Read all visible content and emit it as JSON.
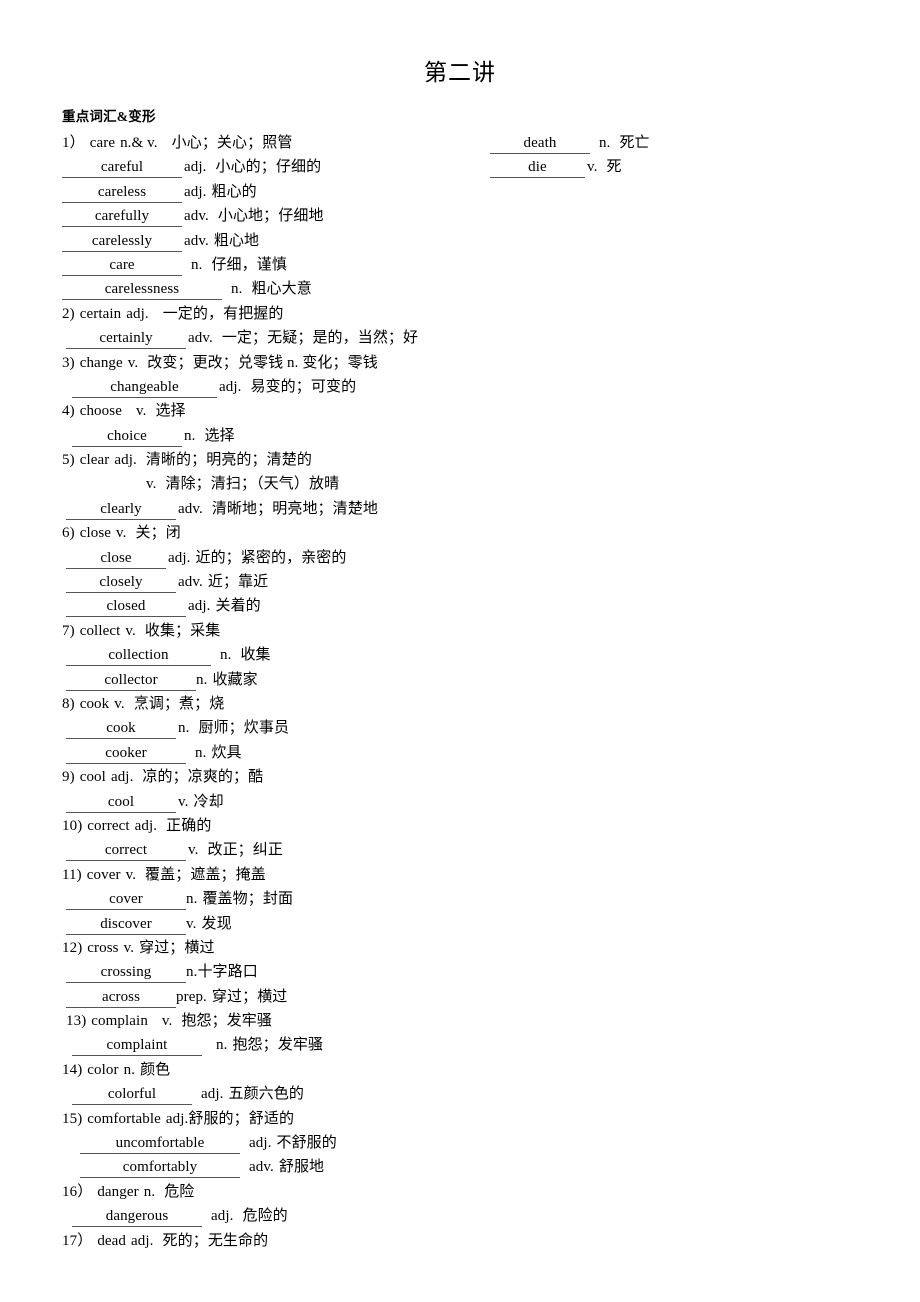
{
  "document": {
    "title": "第二讲",
    "section_heading": "重点词汇&变形"
  },
  "right_column": [
    {
      "blank": "death",
      "pos": "n.",
      "meaning": "死亡"
    },
    {
      "blank": "die",
      "pos": "v.",
      "meaning": "死"
    }
  ],
  "entries": [
    {
      "number": "1）",
      "word": "care",
      "pos": "n.& v.",
      "meaning": "小心；关心；照管",
      "forms": [
        {
          "blank": "careful",
          "pos": "adj.",
          "meaning": "小心的；仔细的"
        },
        {
          "blank": "careless",
          "pos": "adj.",
          "meaning": "粗心的"
        },
        {
          "blank": "carefully",
          "pos": "adv.",
          "meaning": "小心地；仔细地"
        },
        {
          "blank": "carelessly",
          "pos": "adv.",
          "meaning": "粗心地"
        },
        {
          "blank": "care",
          "pos": "n.",
          "meaning": "仔细，谨慎"
        },
        {
          "blank": "carelessness",
          "pos": "n.",
          "meaning": "粗心大意"
        }
      ]
    },
    {
      "number": "2)",
      "word": "certain",
      "pos": "adj.",
      "meaning": "一定的，有把握的",
      "forms": [
        {
          "blank": "certainly",
          "pos": "adv.",
          "meaning": "一定；无疑；是的，当然；好"
        }
      ]
    },
    {
      "number": "3)",
      "word": "change",
      "pos": "v.",
      "meaning": "改变；更改；兑零钱 n. 变化；零钱",
      "forms": [
        {
          "blank": "changeable",
          "pos": "adj.",
          "meaning": "易变的；可变的"
        }
      ]
    },
    {
      "number": "4)",
      "word": "choose",
      "pos": "v.",
      "meaning": "选择",
      "forms": [
        {
          "blank": "choice",
          "pos": "n.",
          "meaning": "选择"
        }
      ]
    },
    {
      "number": "5)",
      "word": "clear",
      "pos": "adj.",
      "meaning": "清晰的；明亮的；清楚的",
      "extra_sense": {
        "pos": "v.",
        "meaning": "清除；清扫；（天气）放晴"
      },
      "forms": [
        {
          "blank": "clearly",
          "pos": "adv.",
          "meaning": "清晰地；明亮地；清楚地"
        }
      ]
    },
    {
      "number": "6)",
      "word": "close",
      "pos": "v.",
      "meaning": "关；闭",
      "forms": [
        {
          "blank": "close",
          "pos": "adj.",
          "meaning": "近的；紧密的，亲密的"
        },
        {
          "blank": "closely",
          "pos": "adv.",
          "meaning": "近；靠近"
        },
        {
          "blank": "closed",
          "pos": "adj.",
          "meaning": "关着的"
        }
      ]
    },
    {
      "number": "7)",
      "word": "collect",
      "pos": "v.",
      "meaning": "收集；采集",
      "forms": [
        {
          "blank": "collection",
          "pos": "n.",
          "meaning": "收集"
        },
        {
          "blank": "collector",
          "pos": "n.",
          "meaning": "收藏家"
        }
      ]
    },
    {
      "number": "8)",
      "word": "cook",
      "pos": "v.",
      "meaning": "烹调；煮；烧",
      "forms": [
        {
          "blank": "cook",
          "pos": "n.",
          "meaning": "厨师；炊事员"
        },
        {
          "blank": "cooker",
          "pos": "n.",
          "meaning": "炊具"
        }
      ]
    },
    {
      "number": "9)",
      "word": "cool",
      "pos": "adj.",
      "meaning": "凉的；凉爽的；酷",
      "forms": [
        {
          "blank": "cool",
          "pos": "v.",
          "meaning": "冷却"
        }
      ]
    },
    {
      "number": "10)",
      "word": "correct",
      "pos": "adj.",
      "meaning": "正确的",
      "forms": [
        {
          "blank": "correct",
          "pos": "v.",
          "meaning": "改正；纠正"
        }
      ]
    },
    {
      "number": "11)",
      "word": "cover",
      "pos": "v.",
      "meaning": "覆盖；遮盖；掩盖",
      "forms": [
        {
          "blank": "cover",
          "pos": "n.",
          "meaning": "覆盖物；封面"
        },
        {
          "blank": "discover",
          "pos": "v.",
          "meaning": "发现"
        }
      ]
    },
    {
      "number": "12)",
      "word": "cross",
      "pos": "v.",
      "meaning": "穿过；横过",
      "forms": [
        {
          "blank": "crossing",
          "pos": "n.",
          "meaning": "十字路口"
        },
        {
          "blank": "across",
          "pos": "prep.",
          "meaning": "穿过；横过"
        }
      ]
    },
    {
      "number": "13)",
      "word": "complain",
      "pos": "v.",
      "meaning": "抱怨；发牢骚",
      "forms": [
        {
          "blank": "complaint",
          "pos": "n.",
          "meaning": "抱怨；发牢骚"
        }
      ]
    },
    {
      "number": "14)",
      "word": "color",
      "pos": "n.",
      "meaning": "颜色",
      "forms": [
        {
          "blank": "colorful",
          "pos": "adj.",
          "meaning": "五颜六色的"
        }
      ]
    },
    {
      "number": "15)",
      "word": "comfortable",
      "pos": "adj.",
      "meaning": "舒服的；舒适的",
      "forms": [
        {
          "blank": "uncomfortable",
          "pos": "adj.",
          "meaning": "不舒服的"
        },
        {
          "blank": "comfortably",
          "pos": "adv.",
          "meaning": "舒服地"
        }
      ]
    },
    {
      "number": "16）",
      "word": "danger",
      "pos": "n.",
      "meaning": "危险",
      "forms": [
        {
          "blank": "dangerous",
          "pos": "adj.",
          "meaning": "危险的"
        }
      ]
    },
    {
      "number": "17）",
      "word": "dead",
      "pos": "adj.",
      "meaning": "死的；无生命的",
      "forms": []
    }
  ]
}
